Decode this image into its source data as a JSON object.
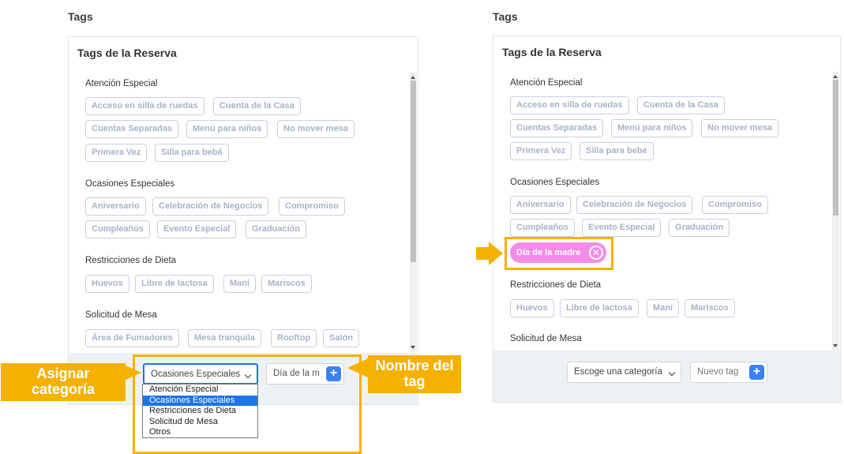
{
  "left": {
    "heading": "Tags",
    "card_title": "Tags de la Reserva",
    "categories": [
      {
        "name": "Atención Especial",
        "tags": [
          "Acceso en silla de ruedas",
          "Cuenta de la Casa",
          "Cuentas Separadas",
          "Menú para niños",
          "No mover mesa",
          "Primera Vez",
          "Silla para bebé"
        ]
      },
      {
        "name": "Ocasiones Especiales",
        "tags": [
          "Aniversario",
          "Celebración de Negocios",
          "Compromiso",
          "Cumpleaños",
          "Evento Especial",
          "Graduación"
        ]
      },
      {
        "name": "Restricciones de Dieta",
        "tags": [
          "Huevos",
          "Libre de lactosa",
          "Maní",
          "Mariscos"
        ]
      },
      {
        "name": "Solicitud de Mesa",
        "tags": [
          "Área de Fumadores",
          "Mesa tranquila",
          "Rooftop",
          "Salón"
        ]
      }
    ],
    "select_value": "Ocasiones Especiales",
    "input_value": "Día de la m",
    "plus": "+",
    "dropdown_options": [
      "Atención Especial",
      "Ocasiones Especiales",
      "Restricciones de Dieta",
      "Solicitud de Mesa",
      "Otros"
    ],
    "dropdown_selected": "Ocasiones Especiales",
    "callout_assign": "Asignar categoría",
    "callout_name": "Nombre del tag"
  },
  "right": {
    "heading": "Tags",
    "card_title": "Tags de la Reserva",
    "categories": [
      {
        "name": "Atención Especial",
        "tags": [
          "Acceso en silla de ruedas",
          "Cuenta de la Casa",
          "Cuentas Separadas",
          "Menú para niños",
          "No mover mesa",
          "Primera Vez",
          "Silla para bebé"
        ]
      },
      {
        "name": "Ocasiones Especiales",
        "tags": [
          "Aniversario",
          "Celebración de Negocios",
          "Compromiso",
          "Cumpleaños",
          "Evento Especial",
          "Graduación"
        ]
      },
      {
        "name": "Restricciones de Dieta",
        "tags": [
          "Huevos",
          "Libre de lactosa",
          "Maní",
          "Mariscos"
        ]
      },
      {
        "name": "Solicitud de Mesa",
        "tags": []
      }
    ],
    "new_tag": "Día de la madre",
    "select_placeholder": "Escoge una categoría",
    "input_placeholder": "Nuevo tag",
    "plus": "+"
  },
  "colors": {
    "highlight": "#f5b100",
    "new_tag_bg": "#f48ce7",
    "plus_button": "#3b82f6",
    "tag_border": "#c7d0e0",
    "tag_text": "#a7b3c7"
  }
}
